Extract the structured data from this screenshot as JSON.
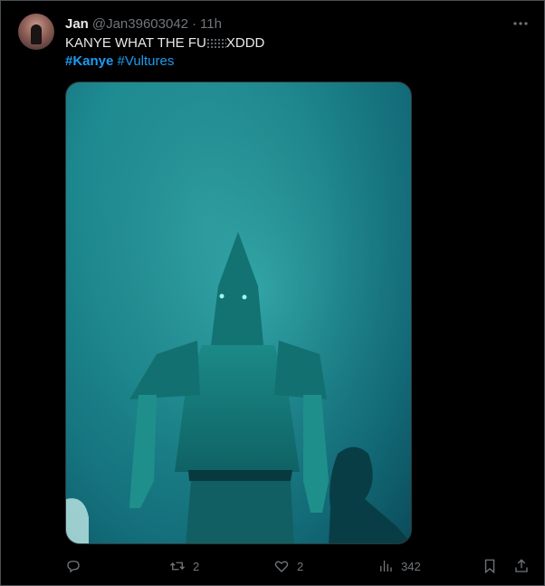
{
  "tweet": {
    "author_name": "Jan",
    "handle": "@Jan39603042",
    "separator": "·",
    "time": "11h",
    "text_before": "KANYE WHAT THE FU",
    "text_after": "XDDD",
    "hashtags": [
      "#Kanye",
      "#Vultures"
    ]
  },
  "actions": {
    "reply_count": "",
    "retweet_count": "2",
    "like_count": "2",
    "views_count": "342"
  },
  "icons": {
    "more": "more-horizontal-icon",
    "reply": "reply-icon",
    "retweet": "retweet-icon",
    "like": "heart-icon",
    "views": "views-chart-icon",
    "bookmark": "bookmark-icon",
    "share": "share-icon"
  },
  "colors": {
    "background": "#000000",
    "text": "#e7e9ea",
    "secondary": "#71767b",
    "link": "#1d9bf0",
    "media_tint": "#1f8d93"
  }
}
